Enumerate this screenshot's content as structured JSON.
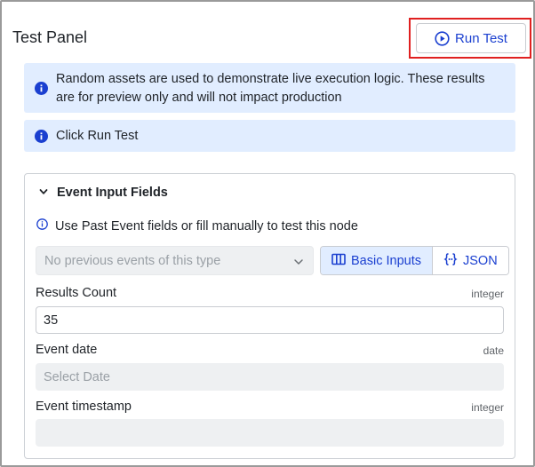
{
  "panel": {
    "title": "Test Panel",
    "run_button_label": "Run Test"
  },
  "notices": [
    {
      "text": "Random assets are used to demonstrate live execution logic. These results are for preview only and will not impact production"
    },
    {
      "text": "Click Run Test"
    }
  ],
  "event_input": {
    "section_title": "Event Input Fields",
    "expanded": true,
    "hint": "Use Past Event fields or fill manually to test this node",
    "past_events_select": {
      "placeholder": "No previous events of this type"
    },
    "mode_tabs": [
      {
        "label": "Basic Inputs",
        "active": true
      },
      {
        "label": "JSON",
        "active": false
      }
    ],
    "fields": [
      {
        "label": "Results Count",
        "type": "integer",
        "value": "35",
        "placeholder": ""
      },
      {
        "label": "Event date",
        "type": "date",
        "value": "",
        "placeholder": "Select Date"
      },
      {
        "label": "Event timestamp",
        "type": "integer",
        "value": "",
        "placeholder": ""
      }
    ]
  },
  "colors": {
    "accent": "#1a3fd0",
    "info_bg": "#e1edff",
    "highlight": "#e02020",
    "disabled_bg": "#eef0f2"
  },
  "icons": {
    "run": "play-circle-icon",
    "info": "info-circle-icon",
    "collapse": "chevron-down-icon",
    "basic_inputs": "columns-icon",
    "json": "braces-icon"
  }
}
